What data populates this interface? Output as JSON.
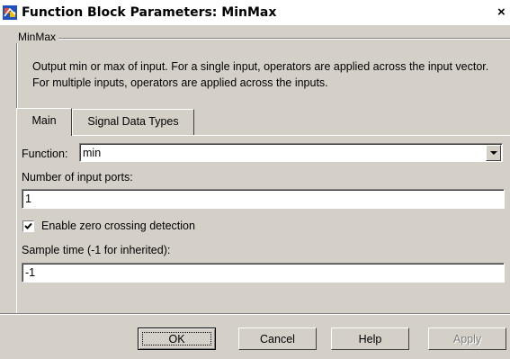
{
  "window": {
    "title": "Function Block Parameters: MinMax",
    "close_glyph": "×",
    "icon": "simulink-block-icon"
  },
  "description_group": {
    "legend": "MinMax",
    "text": "Output min or max of input.  For a single input, operators are applied across the input vector.  For multiple inputs, operators are applied across the inputs."
  },
  "tabs": [
    {
      "label": "Main",
      "selected": true
    },
    {
      "label": "Signal Data Types",
      "selected": false
    }
  ],
  "main": {
    "function_label": "Function:",
    "function_value": "min",
    "num_ports_label": "Number of input ports:",
    "num_ports_value": "1",
    "zero_crossing_label": "Enable zero crossing detection",
    "zero_crossing_checked": true,
    "sample_time_label": "Sample time (-1 for inherited):",
    "sample_time_value": "-1"
  },
  "buttons": {
    "ok": "OK",
    "cancel": "Cancel",
    "help": "Help",
    "apply": "Apply",
    "apply_enabled": false
  },
  "colors": {
    "dialog_face": "#d4d0c8",
    "title_background": "#ffffff"
  }
}
